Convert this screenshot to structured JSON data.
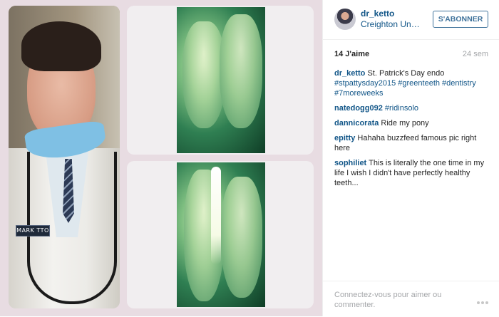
{
  "post": {
    "nametag_text": "MARK  TTO"
  },
  "header": {
    "username": "dr_ketto",
    "location": "Creighton Univ...",
    "follow_label": "S'ABONNER",
    "accent": "#3f729b",
    "link_color": "#125688"
  },
  "stats": {
    "likes": "14 J'aime",
    "age": "24 sem"
  },
  "caption": {
    "user": "dr_ketto",
    "text": "St. Patrick's Day endo",
    "tags": "#stpattysday2015 #greenteeth #dentistry #7moreweeks"
  },
  "comments": [
    {
      "user": "natedogg092",
      "text": "#ridinsolo"
    },
    {
      "user": "dannicorata",
      "text": "Ride my pony"
    },
    {
      "user": "epitty",
      "text": "Hahaha buzzfeed famous pic right here"
    },
    {
      "user": "sophiliet",
      "text": "This is literally the one time in my life I wish I didn't have perfectly healthy teeth..."
    }
  ],
  "footer": {
    "login_prompt": "Connectez-vous pour aimer ou commenter.",
    "more_icon": "more-dots-icon"
  }
}
